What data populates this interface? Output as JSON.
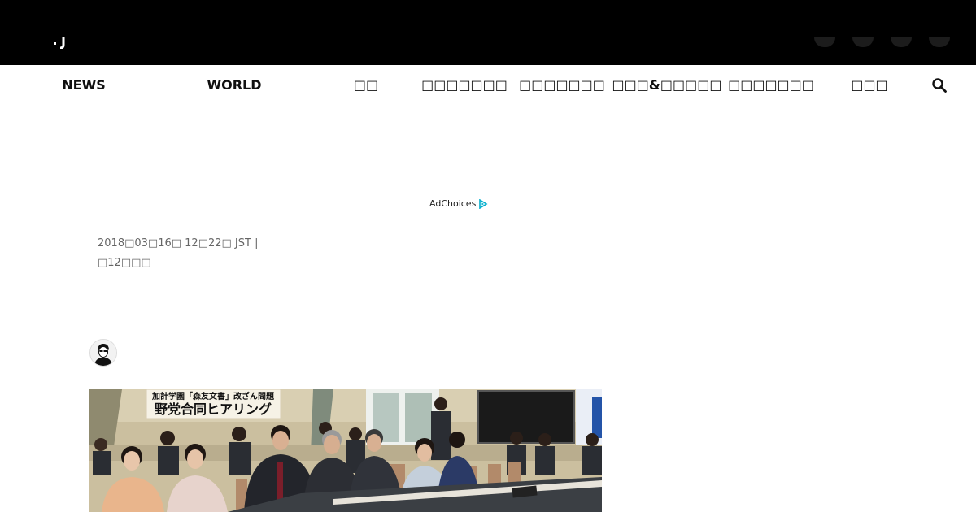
{
  "nav": {
    "items": [
      {
        "id": "news",
        "label": "NEWS"
      },
      {
        "id": "world",
        "label": "WORLD"
      },
      {
        "id": "item3",
        "label": "□□"
      },
      {
        "id": "item4",
        "label": "□□□□□□□"
      },
      {
        "id": "item5",
        "label": "□□□□□□□"
      },
      {
        "id": "item6",
        "label": "□□□&□□□□□"
      },
      {
        "id": "item7",
        "label": "□□□□□□□"
      },
      {
        "id": "item8",
        "label": "□□□"
      }
    ]
  },
  "ad": {
    "label": "AdChoices",
    "accent": "#00aecd"
  },
  "article": {
    "timestamp": "2018□03□16□ 12□22□ JST |",
    "readtime": "□12□□□",
    "banner_line1": "加計学園「森友文書」改ざん問題",
    "banner_line2": "野党合同ヒアリング"
  },
  "colors": {
    "topbar": "#000000",
    "nav_bg": "#ffffff",
    "meta_text": "#666666"
  }
}
